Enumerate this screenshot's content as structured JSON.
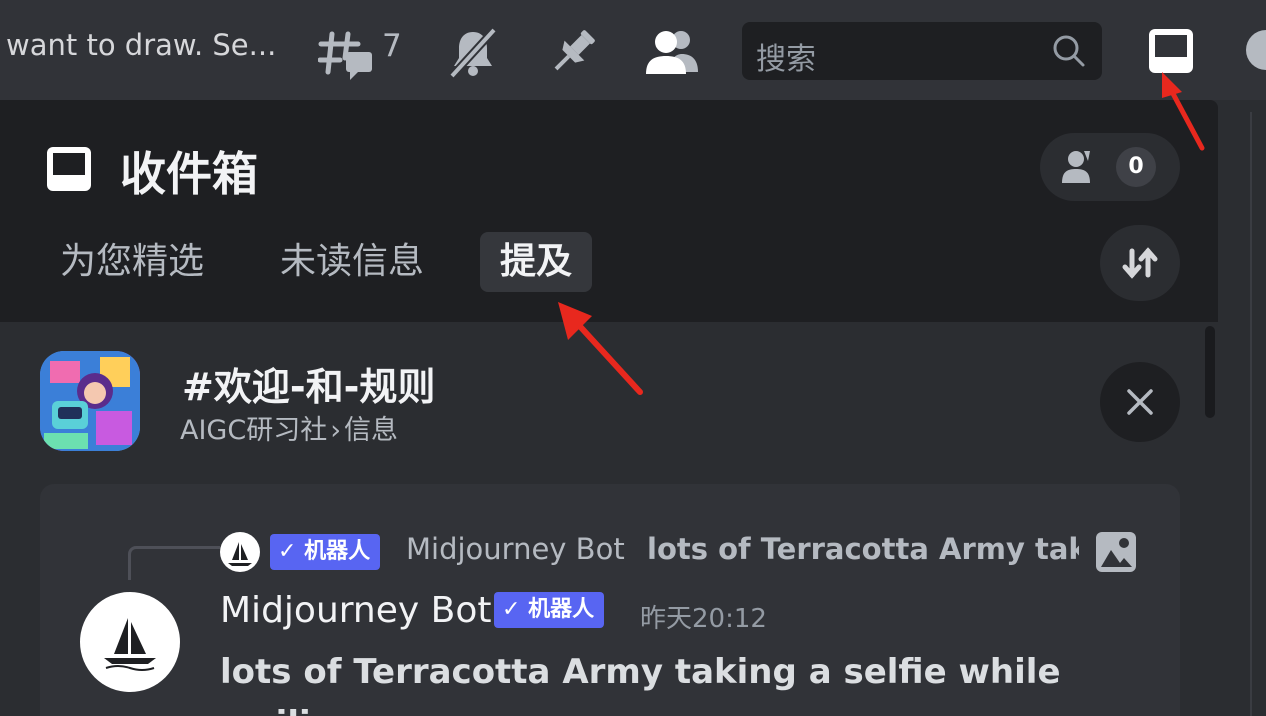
{
  "topbar": {
    "channel_topic": "want to draw. Se...",
    "threads_count": "7",
    "search_placeholder": "搜索",
    "icons": [
      "threads-icon",
      "mute-bell-icon",
      "pin-icon",
      "members-icon",
      "search-icon",
      "inbox-icon",
      "help-icon"
    ]
  },
  "inbox": {
    "title": "收件箱",
    "mention_count": "0",
    "tabs": [
      {
        "label": "为您精选",
        "active": false
      },
      {
        "label": "未读信息",
        "active": false
      },
      {
        "label": "提及",
        "active": true
      }
    ]
  },
  "channel": {
    "name": "#欢迎-和-规则",
    "server": "AIGC研习社",
    "separator": "›",
    "subchannel": "信息"
  },
  "message": {
    "reply": {
      "bot_badge": "✓ 机器人",
      "author": "Midjourney Bot",
      "text": "lots of Terracotta Army taking"
    },
    "author": "Midjourney Bot",
    "bot_badge": "✓ 机器人",
    "timestamp": "昨天20:12",
    "body": "lots of Terracotta Army taking a selfie while smiling"
  },
  "colors": {
    "accent": "#5865f2",
    "annotation_arrow": "#e8281e"
  }
}
